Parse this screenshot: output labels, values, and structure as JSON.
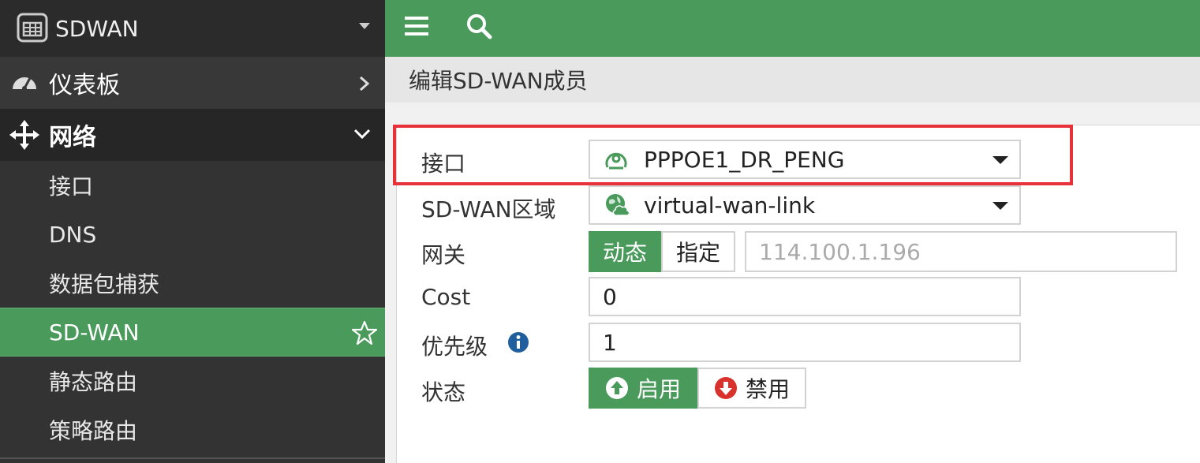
{
  "sidebar": {
    "title": "SDWAN",
    "items": [
      {
        "label": "仪表板"
      },
      {
        "label": "网络"
      }
    ],
    "sub_items": [
      {
        "label": "接口"
      },
      {
        "label": "DNS"
      },
      {
        "label": "数据包捕获"
      },
      {
        "label": "SD-WAN"
      },
      {
        "label": "静态路由"
      },
      {
        "label": "策略路由"
      }
    ]
  },
  "page": {
    "title": "编辑SD-WAN成员"
  },
  "form": {
    "interface": {
      "label": "接口",
      "value": "PPPOE1_DR_PENG"
    },
    "zone": {
      "label": "SD-WAN区域",
      "value": "virtual-wan-link"
    },
    "gateway": {
      "label": "网关",
      "dynamic_label": "动态",
      "specify_label": "指定",
      "placeholder": "114.100.1.196"
    },
    "cost": {
      "label": "Cost",
      "value": "0"
    },
    "priority": {
      "label": "优先级",
      "value": "1"
    },
    "status": {
      "label": "状态",
      "enable_label": "启用",
      "disable_label": "禁用"
    }
  },
  "colors": {
    "accent": "#4a9a5c",
    "highlight": "#e8323a",
    "sidebar": "#333333"
  }
}
